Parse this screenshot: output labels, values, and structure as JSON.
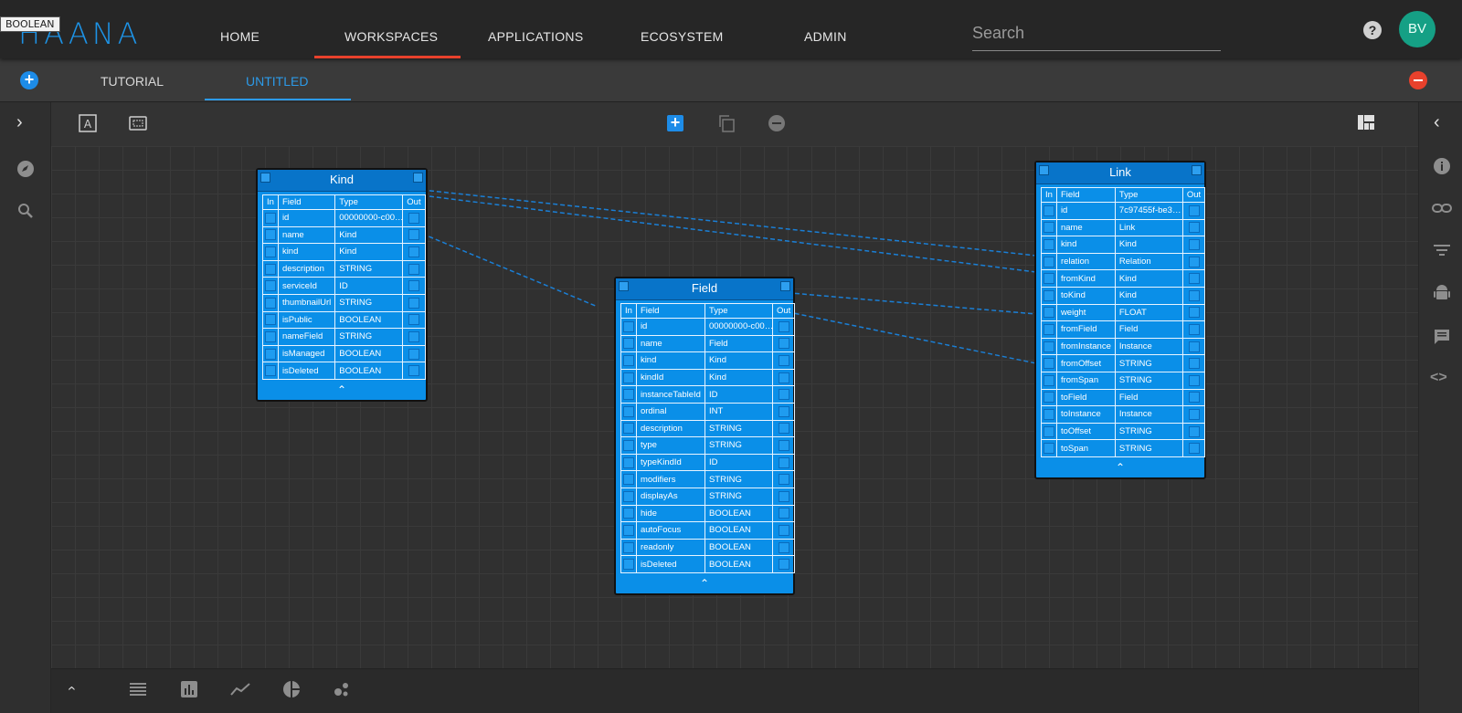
{
  "header": {
    "logo": "HAANA",
    "tooltip": "BOOLEAN",
    "nav": [
      "HOME",
      "WORKSPACES",
      "APPLICATIONS",
      "ECOSYSTEM",
      "ADMIN"
    ],
    "search_placeholder": "Search",
    "help": "?",
    "avatar": "BV"
  },
  "tabs": [
    "TUTORIAL",
    "UNTITLED"
  ],
  "colors": {
    "accent": "#1d8ce8",
    "nav_active": "#e8412c",
    "node": "#0a8fe8",
    "avatar": "#15a085"
  },
  "toolbar_icons": [
    "text-select-icon",
    "fit-screen-icon",
    "add-node-icon",
    "copy-icon",
    "remove-icon",
    "layout-icon"
  ],
  "sidebar_icons": [
    "compass-icon",
    "search-icon"
  ],
  "rightbar_icons": [
    "info-icon",
    "link-icon",
    "filter-icon",
    "android-icon",
    "comment-icon",
    "code-icon"
  ],
  "bottombar_icons": [
    "collapse-up-icon",
    "list-icon",
    "bar-chart-icon",
    "line-chart-icon",
    "pie-chart-icon",
    "scatter-icon"
  ],
  "nodes": {
    "kind": {
      "title": "Kind",
      "headers": [
        "In",
        "Field",
        "Type",
        "Out"
      ],
      "rows": [
        [
          "id",
          "00000000-c00…"
        ],
        [
          "name",
          "Kind"
        ],
        [
          "kind",
          "Kind"
        ],
        [
          "description",
          "STRING"
        ],
        [
          "serviceId",
          "ID"
        ],
        [
          "thumbnailUrl",
          "STRING"
        ],
        [
          "isPublic",
          "BOOLEAN"
        ],
        [
          "nameField",
          "STRING"
        ],
        [
          "isManaged",
          "BOOLEAN"
        ],
        [
          "isDeleted",
          "BOOLEAN"
        ]
      ]
    },
    "field": {
      "title": "Field",
      "headers": [
        "In",
        "Field",
        "Type",
        "Out"
      ],
      "rows": [
        [
          "id",
          "00000000-c00…"
        ],
        [
          "name",
          "Field"
        ],
        [
          "kind",
          "Kind"
        ],
        [
          "kindId",
          "Kind"
        ],
        [
          "instanceTableId",
          "ID"
        ],
        [
          "ordinal",
          "INT"
        ],
        [
          "description",
          "STRING"
        ],
        [
          "type",
          "STRING"
        ],
        [
          "typeKindId",
          "ID"
        ],
        [
          "modifiers",
          "STRING"
        ],
        [
          "displayAs",
          "STRING"
        ],
        [
          "hide",
          "BOOLEAN"
        ],
        [
          "autoFocus",
          "BOOLEAN"
        ],
        [
          "readonly",
          "BOOLEAN"
        ],
        [
          "isDeleted",
          "BOOLEAN"
        ]
      ]
    },
    "link": {
      "title": "Link",
      "headers": [
        "In",
        "Field",
        "Type",
        "Out"
      ],
      "rows": [
        [
          "id",
          "7c97455f-be3…"
        ],
        [
          "name",
          "Link"
        ],
        [
          "kind",
          "Kind"
        ],
        [
          "relation",
          "Relation"
        ],
        [
          "fromKind",
          "Kind"
        ],
        [
          "toKind",
          "Kind"
        ],
        [
          "weight",
          "FLOAT"
        ],
        [
          "fromField",
          "Field"
        ],
        [
          "fromInstance",
          "Instance"
        ],
        [
          "fromOffset",
          "STRING"
        ],
        [
          "fromSpan",
          "STRING"
        ],
        [
          "toField",
          "Field"
        ],
        [
          "toInstance",
          "Instance"
        ],
        [
          "toOffset",
          "STRING"
        ],
        [
          "toSpan",
          "STRING"
        ]
      ]
    }
  }
}
